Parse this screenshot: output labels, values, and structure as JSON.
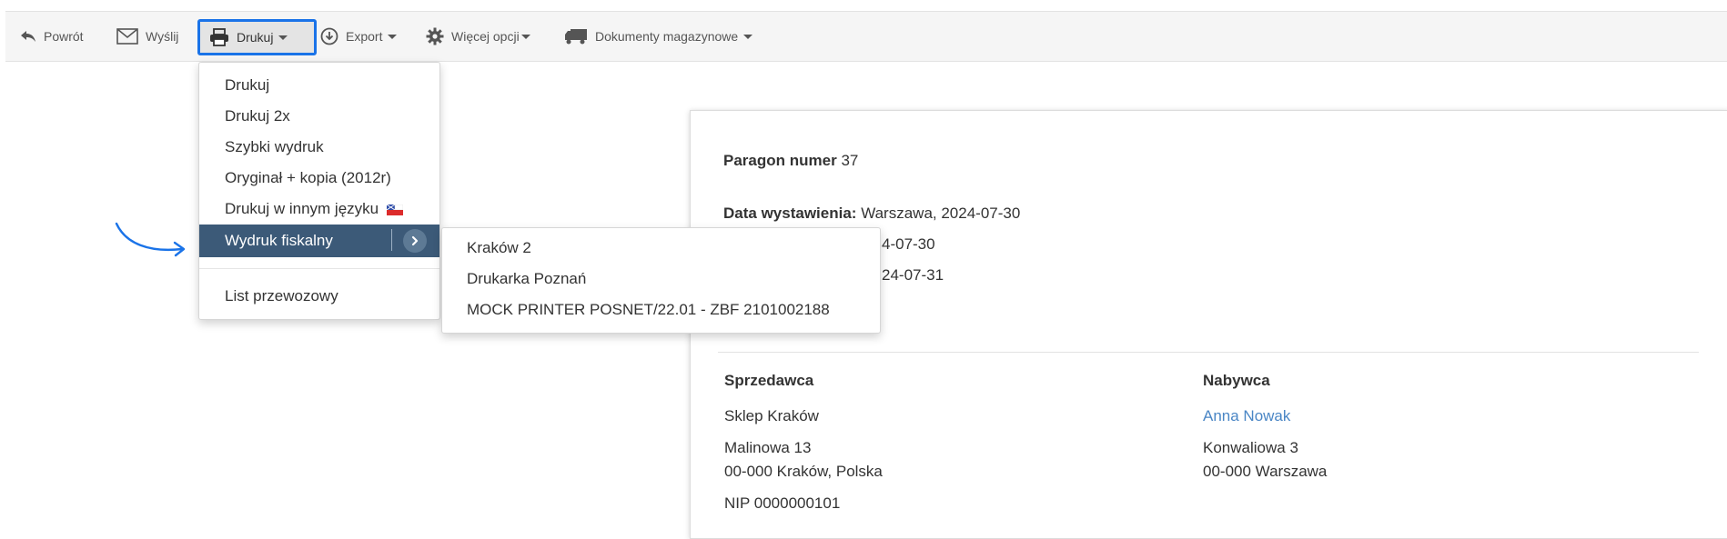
{
  "toolbar": {
    "back": "Powrót",
    "send": "Wyślij",
    "print": "Drukuj",
    "export": "Export",
    "more": "Więcej opcji",
    "warehouse": "Dokumenty magazynowe"
  },
  "print_menu": {
    "items": [
      "Drukuj",
      "Drukuj 2x",
      "Szybki wydruk",
      "Oryginał + kopia (2012r)",
      "Drukuj w innym języku"
    ],
    "fiscal": "Wydruk fiskalny",
    "waybill": "List przewozowy"
  },
  "fiscal_submenu": {
    "items": [
      "Kraków 2",
      "Drukarka Poznań",
      "MOCK PRINTER POSNET/22.01 - ZBF 2101002188"
    ]
  },
  "document": {
    "receipt_label": "Paragon numer",
    "receipt_number": "37",
    "issue_label": "Data wystawienia:",
    "issue_value": "Warszawa, 2024-07-30",
    "line2_partial": "4-07-30",
    "line3_partial": "24-07-31",
    "seller": {
      "heading": "Sprzedawca",
      "name": "Sklep Kraków",
      "street": "Malinowa 13",
      "city": "00-000 Kraków, Polska",
      "nip": "NIP 0000000101"
    },
    "buyer": {
      "heading": "Nabywca",
      "name": "Anna Nowak",
      "street": "Konwaliowa 3",
      "city": "00-000 Warszawa"
    }
  },
  "colors": {
    "highlight_border": "#1a73e8",
    "active_item": "#3c5a78",
    "link": "#4a86c5",
    "arrow": "#1a73e8"
  }
}
